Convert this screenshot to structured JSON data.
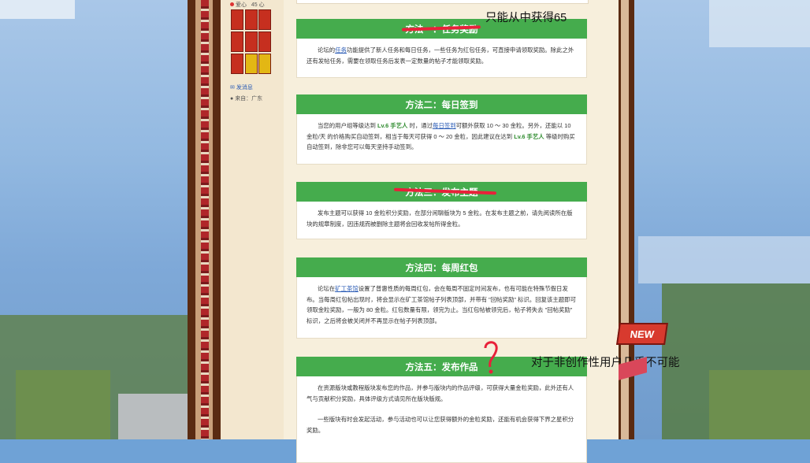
{
  "sidebar": {
    "likes_label": "爱心",
    "likes_count": "45 心",
    "message_link": "发消息",
    "location": "来自：广东"
  },
  "sections": [
    {
      "title": "方法一：任务奖励",
      "paragraphs": [
        [
          "论坛的",
          {
            "link": "任务"
          },
          "功能提供了新人任务和每日任务，一些任务为红包任务，可直接申请领取奖励。除此之外还有发帖任务，需要在领取任务后发表一定数量的帖子才能领取奖励。"
        ]
      ]
    },
    {
      "title": "方法二：每日签到",
      "paragraphs": [
        [
          "当您的用户组等级达到 ",
          {
            "lv": "Lv.6 手艺人"
          },
          " 时，通过",
          {
            "link": "每日签到"
          },
          "可额外获取 10 ～ 30 金粒。另外，还能以 10 金粒/天 的价格购买自动签到，相当于每天可获得 0 ～ 20 金粒，因此建议在达到 ",
          {
            "lv": "Lv.6 手艺人"
          },
          " 等级时购买自动签到，除非您可以每天坚持手动签到。"
        ]
      ]
    },
    {
      "title": "方法三：发布主题",
      "paragraphs": [
        [
          "发布主题可以获得 10 金粒积分奖励，在部分闲聊版块为 5 金粒。在发布主题之前，请先阅读所在版块的规章制度，因违规而被删除主题将会回收发帖所得金粒。"
        ]
      ]
    },
    {
      "title": "方法四：每周红包",
      "paragraphs": [
        [
          "论坛在",
          {
            "link": "矿工茶馆"
          },
          "设置了普惠性质的每周红包，会在每周不固定时间发布，也有可能在特殊节假日发布。当每周红包帖出现时，将会显示在矿工茶馆帖子列表顶部，并带有 \"回帖奖励\" 标识。回复该主题即可领取金粒奖励，一般为 80 金粒。红包数量有限，领完为止。当红包帖被领完后，帖子将失去 \"回帖奖励\" 标识，之后将会被关闭并不再显示在帖子列表顶部。"
        ]
      ]
    },
    {
      "title": "方法五：发布作品",
      "paragraphs": [
        [
          "在资源版块或教程版块发布您的作品，并参与版块内的作品评级，可获得大量金粒奖励，此外还有人气与贡献积分奖励，具体评级方式请见所在版块版规。"
        ],
        [
          "一些版块有时会发起活动，参与活动也可以让您获得额外的金粒奖励，还能有机会获得下界之星积分奖励。"
        ]
      ]
    }
  ],
  "annotations": {
    "top": "只能从中获得65",
    "bottom": "对于非创作性用户几乎不可能"
  },
  "new_badge": "NEW",
  "colors": {
    "header_green": "#45ac4d",
    "annotation_red": "#e8213a",
    "frame_brown": "#5a2b12"
  }
}
